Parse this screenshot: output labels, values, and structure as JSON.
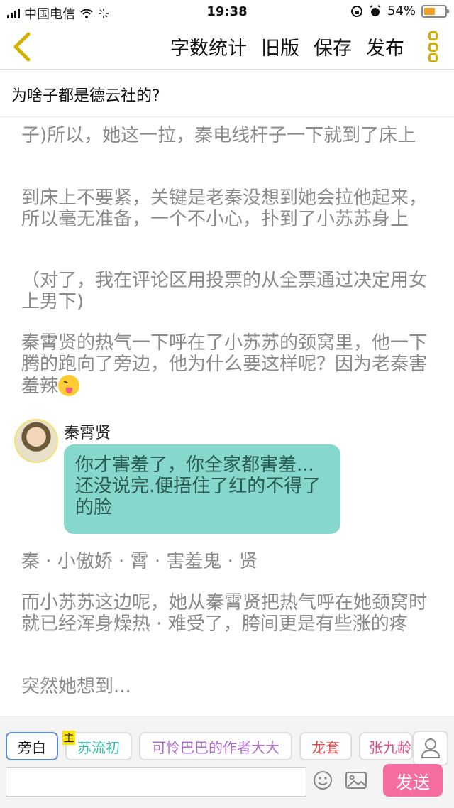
{
  "status_bar": {
    "carrier": "中国电信",
    "time": "19:38",
    "battery_percent": "54%",
    "battery_level": 0.54
  },
  "nav": {
    "actions": [
      "字数统计",
      "旧版",
      "保存",
      "发布"
    ]
  },
  "title": "为啥子都是德云社的?",
  "paragraphs": [
    "子)所以，她这一拉，秦电线杆子一下就到了床上",
    "到床上不要紧，关键是老秦没想到她会拉他起来，所以毫无准备，一个不小心，扑到了小苏苏身上",
    "（对了，我在评论区用投票的从全票通过决定用女上男下)",
    "秦霄贤的热气一下呼在了小苏苏的颈窝里，他一下腾的跑向了旁边，他为什么要这样呢？因为老秦害羞辣"
  ],
  "dialogue": {
    "speaker": "秦霄贤",
    "text": "你才害羞了，你全家都害羞...还没说完.便捂住了红的不得了的脸"
  },
  "paragraphs_after": [
    "秦 · 小傲娇 · 霄 · 害羞鬼 · 贤",
    "而小苏苏这边呢，她从秦霄贤把热气呼在她颈窝时就已经浑身燥热 · 难受了，胯间更是有些涨的疼",
    "突然她想到..."
  ],
  "roles": {
    "narration": "旁白",
    "main_tag": "主",
    "items": [
      "苏流初",
      "可怜巴巴的作者大大",
      "龙套",
      "张九龄"
    ]
  },
  "input": {
    "value": "",
    "send_label": "发送"
  },
  "colors": {
    "accent_yellow": "#d4b100",
    "bubble": "#86d8cc",
    "send": "#f46ca0"
  }
}
